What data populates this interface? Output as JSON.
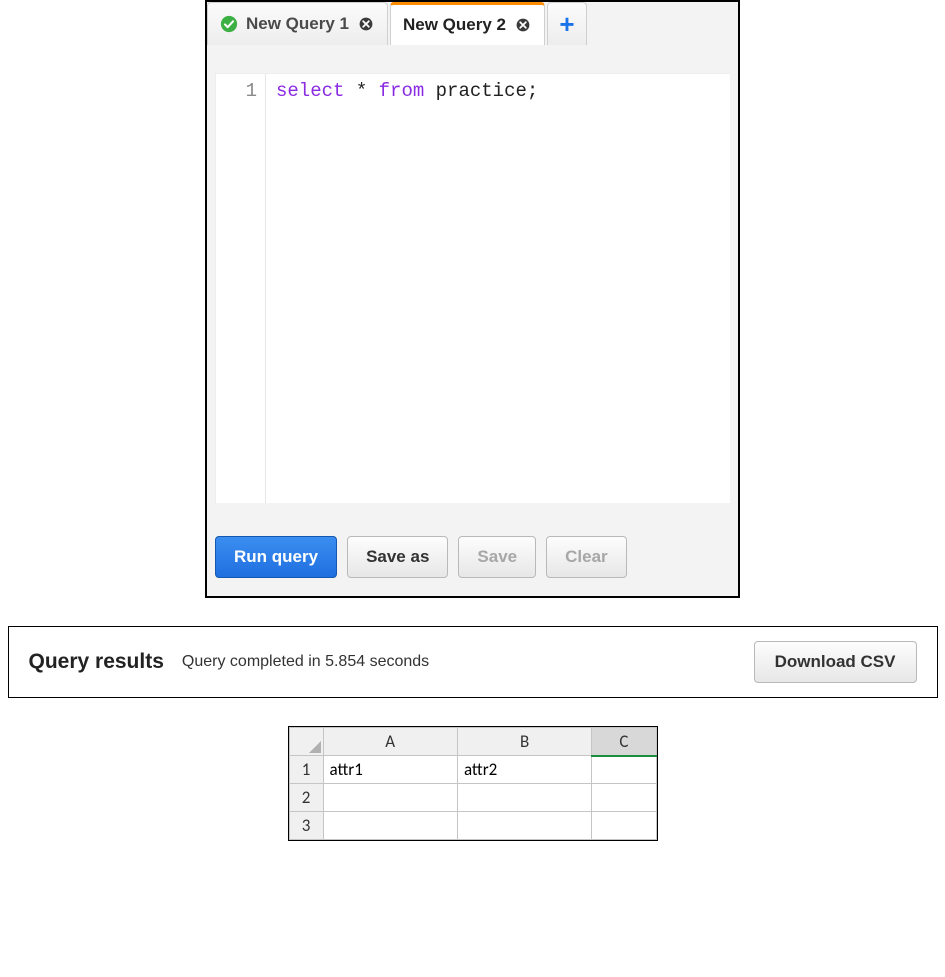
{
  "tabs": [
    {
      "label": "New Query 1",
      "active": false,
      "status": "success"
    },
    {
      "label": "New Query 2",
      "active": true,
      "status": "none"
    }
  ],
  "editor": {
    "line_number": "1",
    "code_select": "select",
    "code_star": " * ",
    "code_from": "from",
    "code_rest": " practice;"
  },
  "buttons": {
    "run": "Run query",
    "save_as": "Save as",
    "save": "Save",
    "clear": "Clear"
  },
  "results": {
    "title": "Query results",
    "status": "Query completed in 5.854 seconds",
    "download": "Download CSV"
  },
  "sheet": {
    "columns": [
      "A",
      "B",
      "C"
    ],
    "selected_column_index": 2,
    "rows": [
      {
        "n": "1",
        "cells": [
          "attr1",
          "attr2",
          ""
        ]
      },
      {
        "n": "2",
        "cells": [
          "",
          "",
          ""
        ]
      },
      {
        "n": "3",
        "cells": [
          "",
          "",
          ""
        ]
      }
    ]
  }
}
